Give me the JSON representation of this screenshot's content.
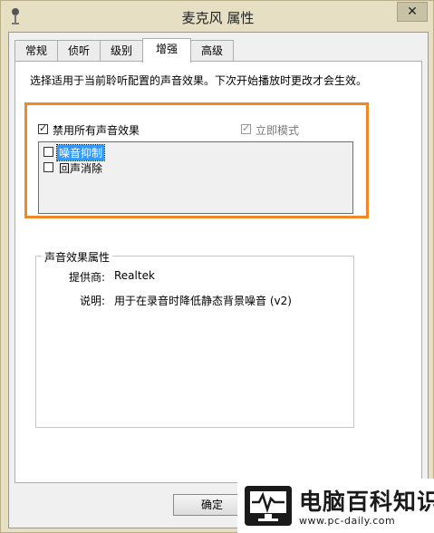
{
  "window": {
    "title": "麦克风 属性",
    "close_symbol": "✕"
  },
  "tabs": [
    {
      "label": "常规"
    },
    {
      "label": "侦听"
    },
    {
      "label": "级别"
    },
    {
      "label": "增强"
    },
    {
      "label": "高级"
    }
  ],
  "enhancements": {
    "description": "选择适用于当前聆听配置的声音效果。下次开始播放时更改才会生效。",
    "disable_all": {
      "label": "禁用所有声音效果",
      "checked": true
    },
    "immediate_mode": {
      "label": "立即模式",
      "checked": true,
      "disabled": true
    },
    "effects": [
      {
        "label": "噪音抑制",
        "checked": false,
        "selected": true
      },
      {
        "label": "回声消除",
        "checked": false,
        "selected": false
      }
    ]
  },
  "properties": {
    "title": "声音效果属性",
    "provider_key": "提供商:",
    "provider_value": "Realtek",
    "description_key": "说明:",
    "description_value": "用于在录音时降低静态背景噪音 (v2)"
  },
  "buttons": {
    "ok": "确定"
  },
  "watermark": {
    "brand": "电脑百科知识",
    "url": "www.pc-daily.com"
  },
  "colors": {
    "highlight": "#f0882a",
    "selection": "#3399ff",
    "titlebar": "#e7dfc4"
  }
}
